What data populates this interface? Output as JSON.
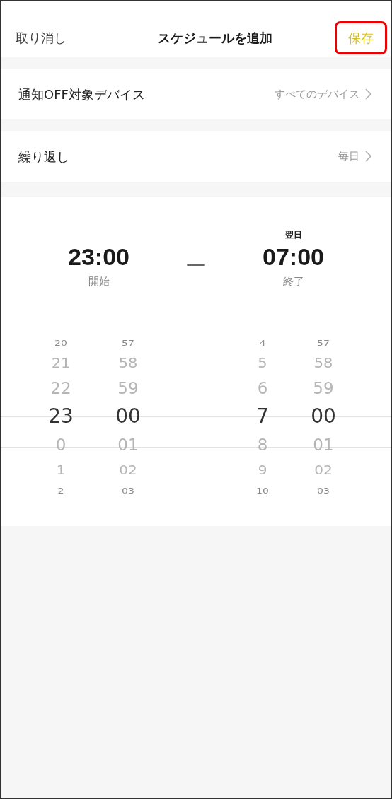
{
  "header": {
    "cancel": "取り消し",
    "title": "スケジュールを追加",
    "save": {
      "label": "保存",
      "highlighted": true
    }
  },
  "rows": [
    {
      "label": "通知OFF対象デバイス",
      "value": "すべてのデバイス"
    },
    {
      "label": "繰り返し",
      "value": "毎日"
    }
  ],
  "summary": {
    "start": {
      "time": "23:00",
      "label": "開始"
    },
    "separator": "—",
    "end": {
      "note": "翌日",
      "time": "07:00",
      "label": "終了"
    }
  },
  "wheels": [
    {
      "items": [
        {
          "text": "20",
          "selected": false
        },
        {
          "text": "21",
          "selected": false
        },
        {
          "text": "22",
          "selected": false
        },
        {
          "text": "23",
          "selected": true
        },
        {
          "text": "0",
          "selected": false
        },
        {
          "text": "1",
          "selected": false
        },
        {
          "text": "2",
          "selected": false
        }
      ]
    },
    {
      "items": [
        {
          "text": "57",
          "selected": false
        },
        {
          "text": "58",
          "selected": false
        },
        {
          "text": "59",
          "selected": false
        },
        {
          "text": "00",
          "selected": true
        },
        {
          "text": "01",
          "selected": false
        },
        {
          "text": "02",
          "selected": false
        },
        {
          "text": "03",
          "selected": false
        }
      ]
    },
    {
      "items": [
        {
          "text": "4",
          "selected": false
        },
        {
          "text": "5",
          "selected": false
        },
        {
          "text": "6",
          "selected": false
        },
        {
          "text": "7",
          "selected": true
        },
        {
          "text": "8",
          "selected": false
        },
        {
          "text": "9",
          "selected": false
        },
        {
          "text": "10",
          "selected": false
        }
      ]
    },
    {
      "items": [
        {
          "text": "57",
          "selected": false
        },
        {
          "text": "58",
          "selected": false
        },
        {
          "text": "59",
          "selected": false
        },
        {
          "text": "00",
          "selected": true
        },
        {
          "text": "01",
          "selected": false
        },
        {
          "text": "02",
          "selected": false
        },
        {
          "text": "03",
          "selected": false
        }
      ]
    }
  ]
}
